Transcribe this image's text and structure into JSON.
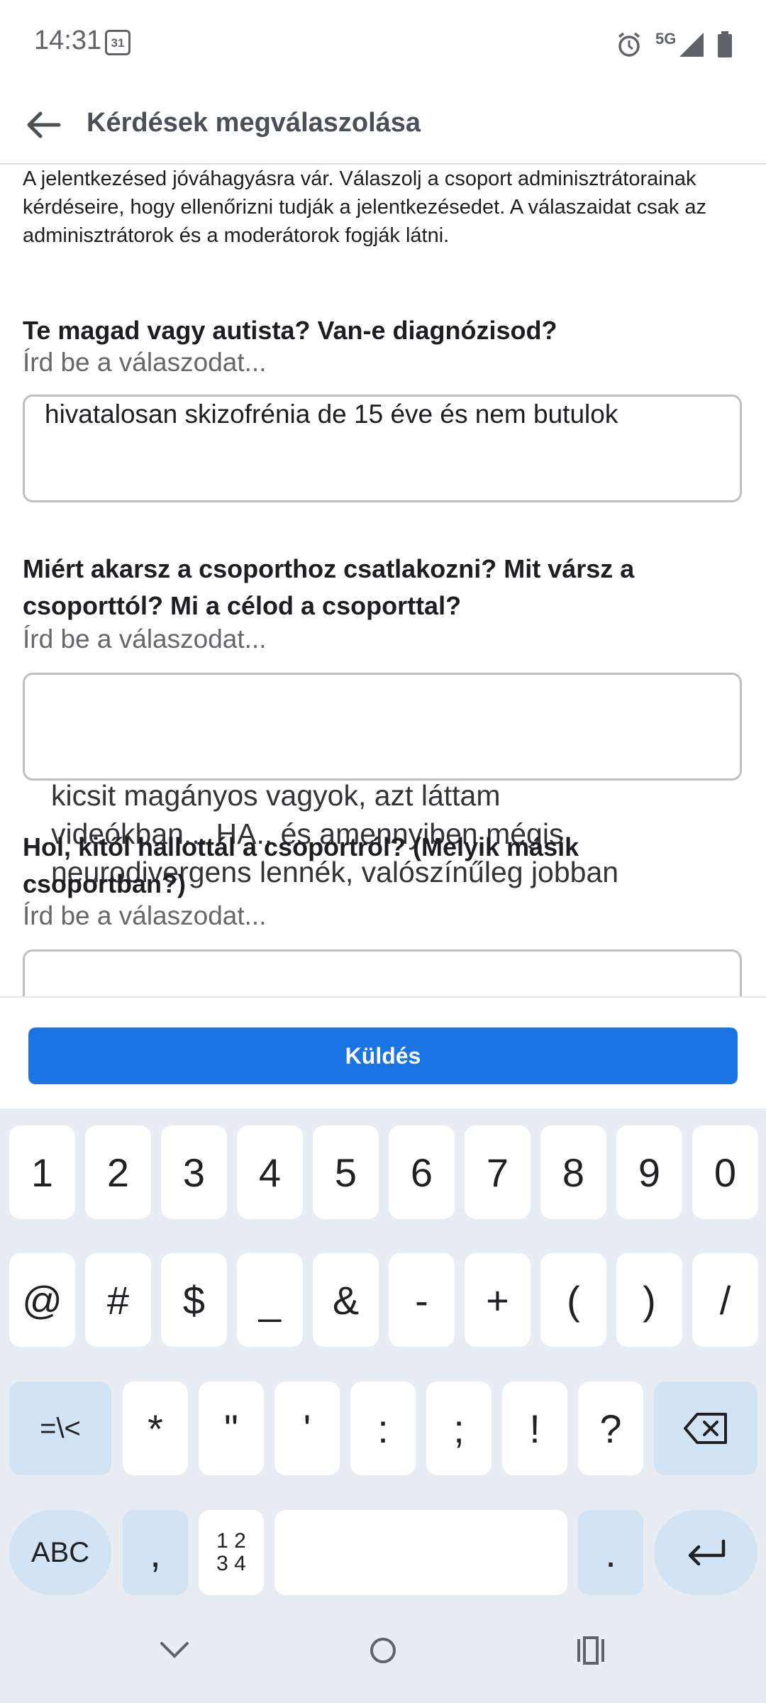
{
  "status_bar": {
    "time": "14:31",
    "calendar_day": "31",
    "network": "5G",
    "icons": [
      "calendar-icon",
      "alarm-icon",
      "signal-icon",
      "battery-icon"
    ]
  },
  "header": {
    "title": "Kérdések megválaszolása",
    "back_icon": "back-arrow-icon"
  },
  "intro_text": "A jelentkezésed jóváhagyásra vár. Válaszolj a csoport adminisztrátorainak kérdéseire, hogy ellenőrizni tudják a jelentkezésedet. A válaszaidat csak az adminisztrátorok és a moderátorok fogják látni.",
  "questions": [
    {
      "title": "Te magad vagy autista? Van-e diagnózisod?",
      "hint": "Írd be a válaszodat...",
      "answer": "hivatalosan skizofrénia de 15 éve és nem butulok"
    },
    {
      "title": "Miért akarsz a csoporthoz csatlakozni? Mit vársz a csoporttól? Mi a célod a csoporttal?",
      "hint": "Írd be a válaszodat...",
      "answer": ""
    },
    {
      "title": "Hol, kitől hallottál a csoportról? (Melyik másik csoportban?)",
      "hint": "Írd be a válaszodat...",
      "answer": ""
    }
  ],
  "overflow_lines": [
    "kicsit magányos vagyok, azt láttam",
    "videókban... HA.. és amennyiben mégis",
    "neurodivergens lennék, valószínűleg jobban"
  ],
  "footer": {
    "send_label": "Küldés"
  },
  "keyboard": {
    "row1": [
      "1",
      "2",
      "3",
      "4",
      "5",
      "6",
      "7",
      "8",
      "9",
      "0"
    ],
    "row2": [
      "@",
      "#",
      "$",
      "_",
      "&",
      "-",
      "+",
      "(",
      ")",
      "/"
    ],
    "row3": [
      "=\\<",
      "*",
      "\"",
      "'",
      ":",
      ";",
      "!",
      "?"
    ],
    "row4": {
      "abc": "ABC",
      "comma": ",",
      "numpad": "1 2\n3 4",
      "period": "."
    },
    "icons": [
      "backspace-icon",
      "enter-icon"
    ]
  },
  "nav_bar": {
    "icons": [
      "nav-back-icon",
      "nav-home-icon",
      "nav-recents-icon"
    ]
  },
  "colors": {
    "accent": "#1b74e4",
    "keyboard_bg": "#e8edf4",
    "mod_key": "#d2e3f3"
  }
}
